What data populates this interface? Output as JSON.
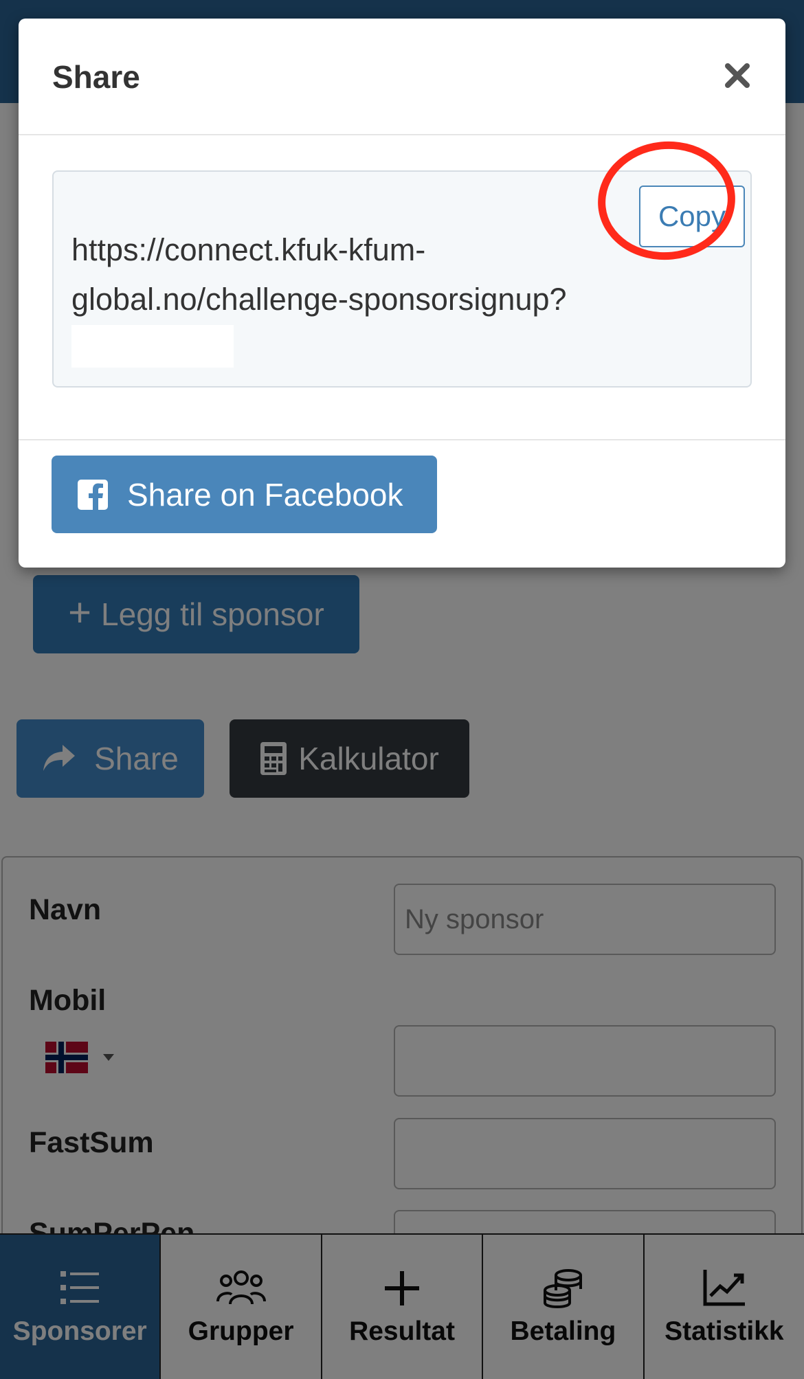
{
  "modal": {
    "title": "Share",
    "close_icon": "close-icon",
    "url_text": "https://connect.kfuk-kfum-global.no/challenge-sponsorsignup?",
    "copy_label": "Copy",
    "facebook_label": "Share on Facebook",
    "facebook_icon": "facebook-square-icon",
    "highlight_color": "#ff2a1a"
  },
  "actions": {
    "add_sponsor_label": "Legg til sponsor",
    "share_label": "Share",
    "calculator_label": "Kalkulator"
  },
  "form": {
    "name_label": "Navn",
    "name_placeholder": "Ny sponsor",
    "mobile_label": "Mobil",
    "country_flag": "norway-flag-icon",
    "fixed_sum_label": "FastSum",
    "per_label_partial": "SumPerPen"
  },
  "tabs": [
    {
      "label": "Sponsorer",
      "icon": "list-icon",
      "active": true
    },
    {
      "label": "Grupper",
      "icon": "users-icon",
      "active": false
    },
    {
      "label": "Resultat",
      "icon": "plus-icon",
      "active": false
    },
    {
      "label": "Betaling",
      "icon": "coins-icon",
      "active": false
    },
    {
      "label": "Statistikk",
      "icon": "chart-line-icon",
      "active": false
    }
  ],
  "colors": {
    "primary": "#337ab7",
    "dark_button": "#343a40",
    "active_tab": "#2a6496"
  }
}
